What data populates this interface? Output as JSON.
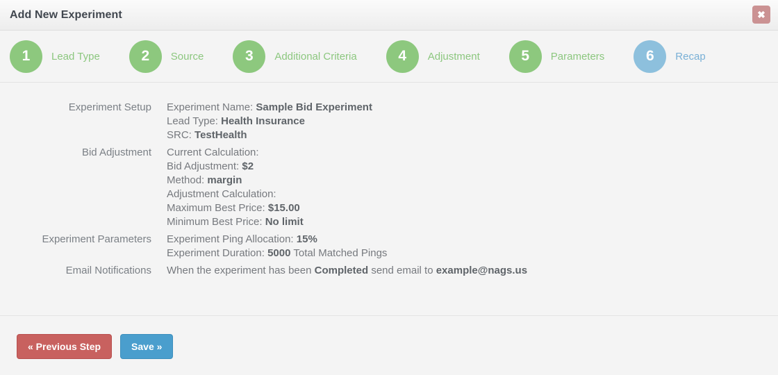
{
  "header": {
    "title": "Add New Experiment",
    "close_label": "✖"
  },
  "steps": [
    {
      "number": "1",
      "label": "Lead Type",
      "state": "green"
    },
    {
      "number": "2",
      "label": "Source",
      "state": "green"
    },
    {
      "number": "3",
      "label": "Additional Criteria",
      "state": "green"
    },
    {
      "number": "4",
      "label": "Adjustment",
      "state": "green"
    },
    {
      "number": "5",
      "label": "Parameters",
      "state": "green"
    },
    {
      "number": "6",
      "label": "Recap",
      "state": "blue"
    }
  ],
  "recap": {
    "rows": [
      {
        "label": "Experiment Setup",
        "lines": [
          {
            "text": "Experiment Name: ",
            "strong": "Sample Bid Experiment",
            "after": ""
          },
          {
            "text": "Lead Type: ",
            "strong": "Health Insurance",
            "after": ""
          },
          {
            "text": "SRC: ",
            "strong": "TestHealth",
            "after": ""
          }
        ]
      },
      {
        "label": "Bid Adjustment",
        "lines": [
          {
            "text": "Current Calculation:",
            "strong": "",
            "after": ""
          },
          {
            "text": "Bid Adjustment: ",
            "strong": "$2",
            "after": ""
          },
          {
            "text": "Method: ",
            "strong": "margin",
            "after": ""
          },
          {
            "text": "Adjustment Calculation:",
            "strong": "",
            "after": ""
          },
          {
            "text": "Maximum Best Price: ",
            "strong": "$15.00",
            "after": ""
          },
          {
            "text": "Minimum Best Price: ",
            "strong": "No limit",
            "after": ""
          }
        ]
      },
      {
        "label": "Experiment Parameters",
        "lines": [
          {
            "text": "Experiment Ping Allocation: ",
            "strong": "15%",
            "after": ""
          },
          {
            "text": "Experiment Duration: ",
            "strong": "5000",
            "after": " Total Matched Pings"
          }
        ]
      },
      {
        "label": "Email Notifications",
        "lines": [
          {
            "text": "When the experiment has been ",
            "strong": "Completed",
            "after": " send email to ",
            "strong2": "example@nags.us"
          }
        ]
      }
    ]
  },
  "footer": {
    "previous_label": "« Previous Step",
    "save_label": "Save »"
  },
  "colors": {
    "step_green": "#8dc87e",
    "step_blue": "#8dc0dd",
    "button_red": "#c8615f",
    "button_blue": "#4a9ecd",
    "close_red": "#cb9293",
    "background": "#f4f4f4"
  }
}
